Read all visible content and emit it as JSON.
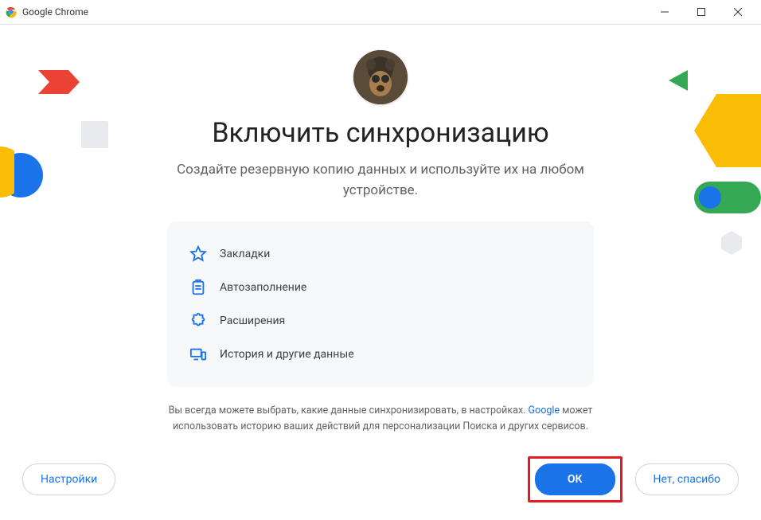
{
  "window": {
    "title": "Google Chrome"
  },
  "main": {
    "heading": "Включить синхронизацию",
    "subtitle": "Создайте резервную копию данных и используйте их на любом устройстве."
  },
  "features": [
    {
      "icon": "star-icon",
      "label": "Закладки"
    },
    {
      "icon": "clipboard-icon",
      "label": "Автозаполнение"
    },
    {
      "icon": "puzzle-icon",
      "label": "Расширения"
    },
    {
      "icon": "devices-icon",
      "label": "История и другие данные"
    }
  ],
  "disclaimer": {
    "text_before": "Вы всегда можете выбрать, какие данные синхронизировать, в настройках. ",
    "link": "Google",
    "text_after": " может использовать историю ваших действий для персонализации Поиска и других сервисов."
  },
  "buttons": {
    "settings": "Настройки",
    "ok": "ОК",
    "no_thanks": "Нет, спасибо"
  }
}
